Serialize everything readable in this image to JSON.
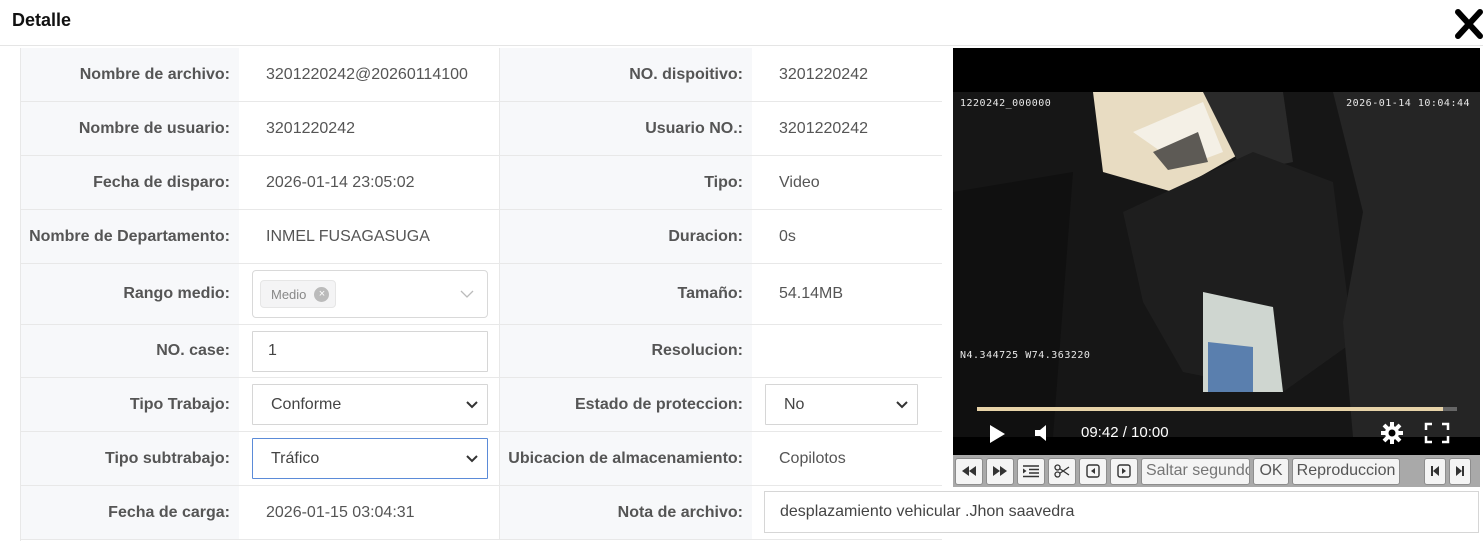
{
  "dialog": {
    "title": "Detalle",
    "close_icon": "close-icon"
  },
  "form": {
    "rows": [
      {
        "l1": "Nombre de archivo:",
        "v1": "3201220242@20260114100",
        "l2": "NO. dispoitivo:",
        "v2": "3201220242"
      },
      {
        "l1": "Nombre de usuario:",
        "v1": "3201220242",
        "l2": "Usuario NO.:",
        "v2": "3201220242"
      },
      {
        "l1": "Fecha de disparo:",
        "v1": "2026-01-14 23:05:02",
        "l2": "Tipo:",
        "v2": "Video"
      },
      {
        "l1": "Nombre de Departamento:",
        "v1": "INMEL FUSAGASUGA",
        "l2": "Duracion:",
        "v2": "0s"
      },
      {
        "l1": "Rango medio:",
        "tag": "Medio",
        "l2": "Tamaño:",
        "v2": "54.14MB"
      },
      {
        "l1": "NO. case:",
        "input": "1",
        "l2": "Resolucion:",
        "v2": ""
      },
      {
        "l1": "Tipo Trabajo:",
        "select": "Conforme",
        "l2": "Estado de proteccion:",
        "select2": "No"
      },
      {
        "l1": "Tipo subtrabajo:",
        "select": "Tráfico",
        "l2": "Ubicacion de almacenamiento:",
        "v2": "Copilotos"
      },
      {
        "l1": "Fecha de carga:",
        "v1": "2026-01-15 03:04:31",
        "l2": "Nota de archivo:",
        "note": "desplazamiento vehicular .Jhon saavedra"
      }
    ]
  },
  "player": {
    "osd_top_left": "1220242_000000",
    "osd_top_right": "2026-01-14 10:04:44",
    "osd_bottom_left": "N4.344725  W74.363220",
    "time": "09:42 / 10:00",
    "progress": 0.97
  },
  "toolbar": {
    "seek_placeholder": "Saltar segundos",
    "ok_label": "OK",
    "playback_label": "Reproduccion"
  },
  "colors": {
    "accent_focus": "#5b8bd8",
    "label_bg": "#f7f8fa",
    "progress": "#e7d3a8"
  }
}
